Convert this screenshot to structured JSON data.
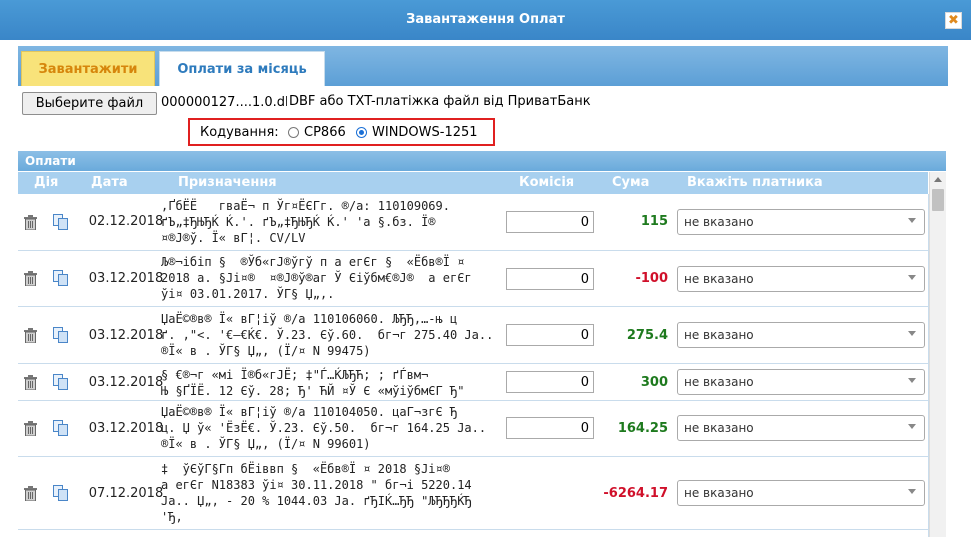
{
  "window": {
    "title": "Завантаження Оплат",
    "close_glyph": "✖"
  },
  "tabs": [
    {
      "label": "Завантажити"
    },
    {
      "label": "Оплати за місяць"
    }
  ],
  "file": {
    "button_label": "Выберите файл",
    "selected_name": "000000127....1.0.dbf",
    "hint": "DBF або TXT-платіжка файл від ПриватБанк"
  },
  "encoding": {
    "label": "Кодування:",
    "options": [
      "CP866",
      "WINDOWS-1251"
    ],
    "selected": "WINDOWS-1251"
  },
  "panel": {
    "title": "Оплати"
  },
  "columns": [
    "Дія",
    "Дата",
    "Призначення",
    "Комісія",
    "Сума",
    "Вкажіть платника"
  ],
  "rows": [
    {
      "date": "02.12.2018",
      "purpose": "‚ҐбЁЁ   гваЁ¬ п Ўг¤ЁЄГг. ®/а: 110109069.\nґЪ„‡ЂЊЂЌ Ќ.'. ґЪ„‡ЂЊЂЌ Ќ.' 'а §.бз. Ї®\n¤®Ј®ў. Ї« вГ¦. CV/LV",
      "commission": "0",
      "sum": "115",
      "payer": "не вказано"
    },
    {
      "date": "03.12.2018",
      "purpose": "Љ®¬ібiп §  ®Ўб«гЈ®ўгў п а егЄг §  «Ёбв®Ї ¤\n2018 а. §Ji¤®  ¤®Ј®ў®аг Ў Єiўбм€®J®  а егЄг\nўi¤ 03.01.2017. ЎГ§ Џ„,.",
      "commission": "0",
      "sum": "-100",
      "payer": "не вказано"
    },
    {
      "date": "03.12.2018",
      "purpose": "ЏаЁ©®в® Ї« вГ¦iў ®/а 110106060. ЉЂЂ,…-њ ц\nґ. ,\"<. '€—€Ќ€. Ў.23. Єў.60.  бг¬г 275.40 Ja..\n®Ї« в . ЎГ§ Џ„, (Ї/¤ N 99475)",
      "commission": "0",
      "sum": "275.4",
      "payer": "не вказано"
    },
    {
      "date": "03.12.2018",
      "purpose": "§ €®¬г «мi Ї®б«гЈЁ; ‡\"Ѓ…ЌЉЂЋ; ; ґЃвм¬\nЊ §ҐЇЁ. 12 Єў. 28; Ђ' ЋЙ ¤Ў Є «мўiўбмЄГ Ђ\"",
      "commission": "0",
      "sum": "300",
      "payer": "не вказано"
    },
    {
      "date": "03.12.2018",
      "purpose": "ЏаЁ©®в® Ї« вГ¦iў ®/а 110104050. цаГ¬згЄ Ђ\nц. Џ ў« 'ЁзЁ€. Ў.23. Єў.50.  бг¬г 164.25 Ja..\n®Ї« в . ЎГ§ Џ„, (Ї/¤ N 99601)",
      "commission": "0",
      "sum": "164.25",
      "payer": "не вказано"
    },
    {
      "date": "07.12.2018",
      "purpose": "‡  ўЄўГ§Гп бЁiввп §  «Ёбв®Ї ¤ 2018 §Ji¤®\nа егЄг N18383 ўi¤ 30.11.2018 \" бг¬i 5220.14\nJa.. Џ„, - 20 % 1044.03 Ja. ґЂIЌ…ЂЂ \"ЉЂЂЂЌЂ\n'Ђ,",
      "commission": "",
      "sum": "-6264.17",
      "payer": "не вказано"
    }
  ]
}
